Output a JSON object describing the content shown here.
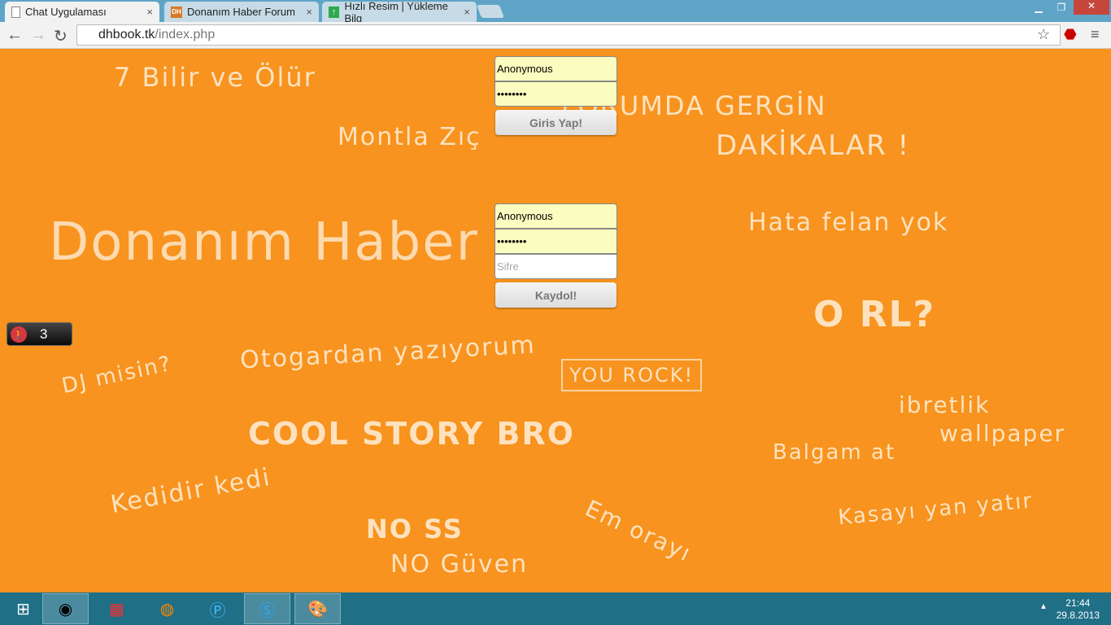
{
  "browser": {
    "tabs": [
      {
        "title": "Chat Uygulaması",
        "icon": "page-icon",
        "active": true
      },
      {
        "title": "Donanım Haber Forum",
        "icon": "dh-favicon"
      },
      {
        "title": "Hızlı Resim | Yükleme Bilg",
        "icon": "upload-arrow-favicon"
      }
    ],
    "close_glyph": "×",
    "url_host": "dhbook.tk",
    "url_path": "/index.php"
  },
  "login": {
    "username": "Anonymous",
    "password": "••••••••",
    "button": "Giris Yap!"
  },
  "register": {
    "username": "Anonymous",
    "password": "••••••••",
    "confirm_placeholder": "Sifre",
    "button": "Kaydol!"
  },
  "online_counter": {
    "count": "3",
    "icon": "walking-person-icon"
  },
  "wallpaper": {
    "texts": [
      "7 Bilir ve Ölür",
      "FORUMDA GERGİN",
      "DAKİKALAR !",
      "Montla Zıç",
      "Donanım Haber",
      "Hata felan yok",
      "O RL?",
      "DJ misin?",
      "Otogardan yazıyorum",
      "YOU ROCK!",
      "ibretlik",
      "wallpaper",
      "COOL STORY BRO",
      "Balgam at",
      "Kedidir kedi",
      "Em orayı",
      "Kasayı yan yatır",
      "NO SS",
      "NO Güven"
    ]
  },
  "taskbar": {
    "time": "21:44",
    "date": "29.8.2013"
  },
  "colors": {
    "background": "#f7931e",
    "input_autofill": "#fbfcbf",
    "taskbar": "#1f6f87"
  }
}
